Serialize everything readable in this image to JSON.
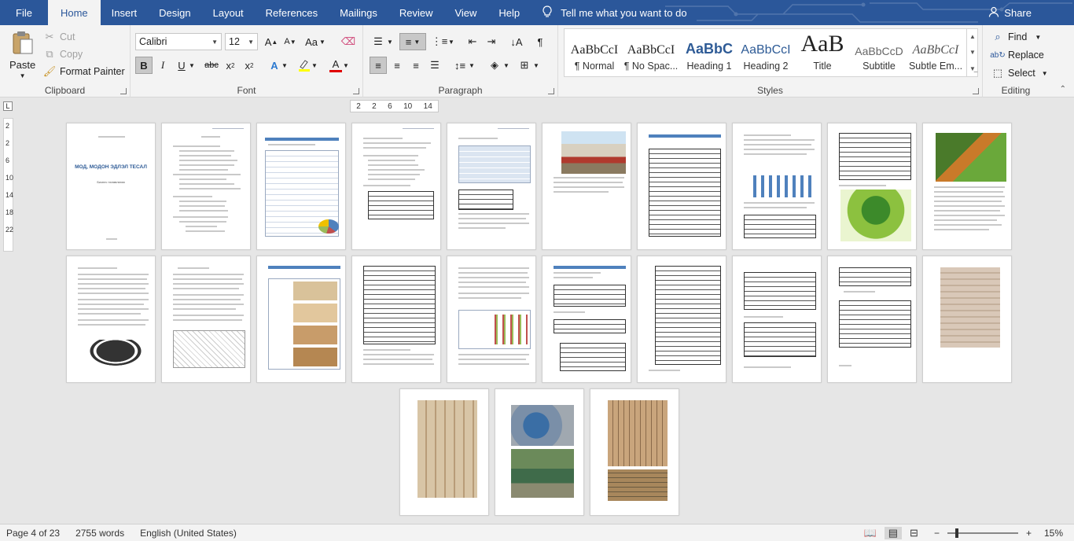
{
  "menu": {
    "tabs": [
      "File",
      "Home",
      "Insert",
      "Design",
      "Layout",
      "References",
      "Mailings",
      "Review",
      "View",
      "Help"
    ],
    "active_tab": "Home",
    "tell_me": "Tell me what you want to do",
    "share": "Share"
  },
  "ribbon": {
    "clipboard": {
      "label": "Clipboard",
      "paste": "Paste",
      "cut": "Cut",
      "copy": "Copy",
      "format_painter": "Format Painter"
    },
    "font": {
      "label": "Font",
      "name": "Calibri",
      "size": "12",
      "change_case": "Aa"
    },
    "paragraph": {
      "label": "Paragraph"
    },
    "styles": {
      "label": "Styles",
      "items": [
        {
          "sample": "AaBbCcI",
          "name": "¶ Normal"
        },
        {
          "sample": "AaBbCcI",
          "name": "¶ No Spac..."
        },
        {
          "sample": "AaBbC",
          "name": "Heading 1"
        },
        {
          "sample": "AaBbCcI",
          "name": "Heading 2"
        },
        {
          "sample": "AaB",
          "name": "Title"
        },
        {
          "sample": "AaBbCcD",
          "name": "Subtitle"
        },
        {
          "sample": "AaBbCcI",
          "name": "Subtle Em..."
        }
      ]
    },
    "editing": {
      "label": "Editing",
      "find": "Find",
      "replace": "Replace",
      "select": "Select"
    }
  },
  "ruler": {
    "ticks": [
      "2",
      "2",
      "6",
      "10",
      "14"
    ]
  },
  "vruler": {
    "ticks": [
      "2",
      "2",
      "6",
      "10",
      "14",
      "18",
      "22"
    ]
  },
  "document": {
    "cover_title": "МОД, МОДОН ЭДЛЭЛ ТЕСАЛ",
    "cover_sub": "Бизнес төлөвлөгөө"
  },
  "status": {
    "page": "Page 4 of 23",
    "words": "2755 words",
    "language": "English (United States)",
    "zoom": "15%"
  },
  "colors": {
    "brand": "#2b579a",
    "table_header": "#4f81bd"
  }
}
